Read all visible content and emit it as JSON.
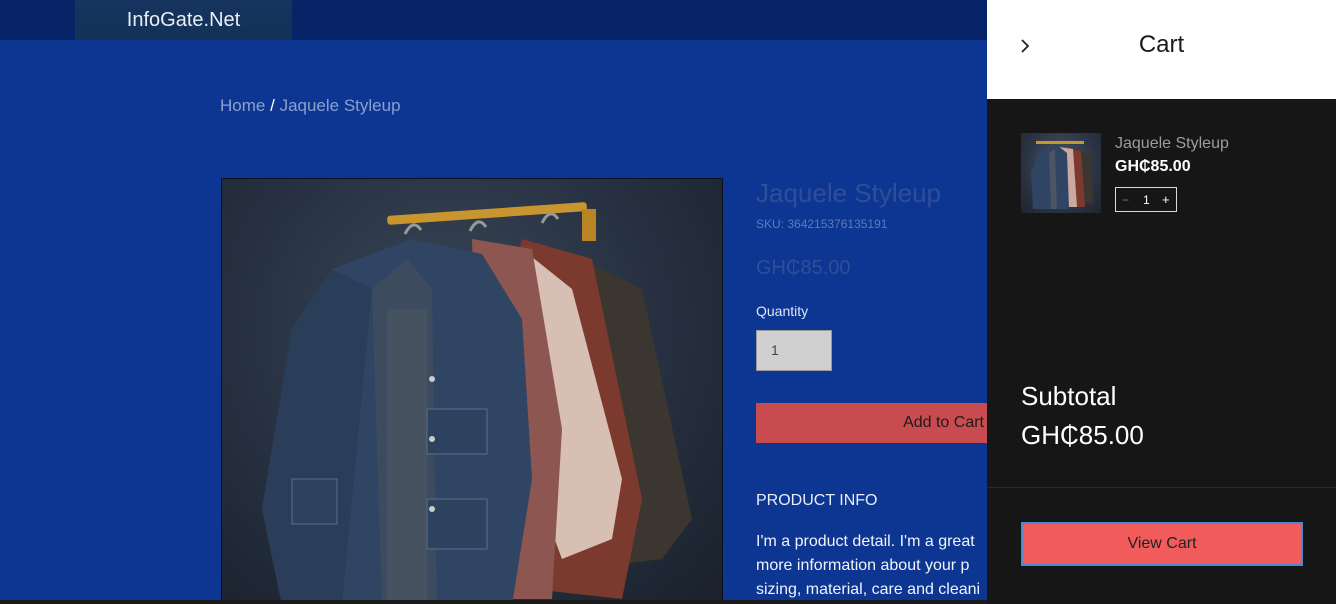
{
  "header": {
    "site_name": "InfoGate.Net"
  },
  "breadcrumb": {
    "home": "Home",
    "separator": "/",
    "current": "Jaquele Styleup"
  },
  "product": {
    "title": "Jaquele Styleup",
    "sku": "SKU: 364215376135191",
    "price": "GH₵85.00",
    "quantity_label": "Quantity",
    "quantity_value": "1",
    "add_to_cart_label": "Add to Cart",
    "info_heading": "PRODUCT INFO",
    "info_lines": [
      "I'm a product detail. I'm a great",
      "more information about your p",
      "sizing, material, care and cleani"
    ]
  },
  "cart": {
    "title": "Cart",
    "items": [
      {
        "name": "Jaquele Styleup",
        "price": "GH₵85.00",
        "quantity": "1",
        "minus": "−",
        "plus": "+"
      }
    ],
    "subtotal_label": "Subtotal",
    "subtotal_value": "GH₵85.00",
    "view_cart_label": "View Cart"
  },
  "colors": {
    "page_bg": "#0d3592",
    "topbar": "#072469",
    "accent_button": "#c84c4f",
    "view_cart_button": "#f25b5b",
    "cart_panel": "#161616"
  },
  "icons": {
    "close": "chevron-right-icon",
    "product_image": "jackets-on-rack-image"
  }
}
